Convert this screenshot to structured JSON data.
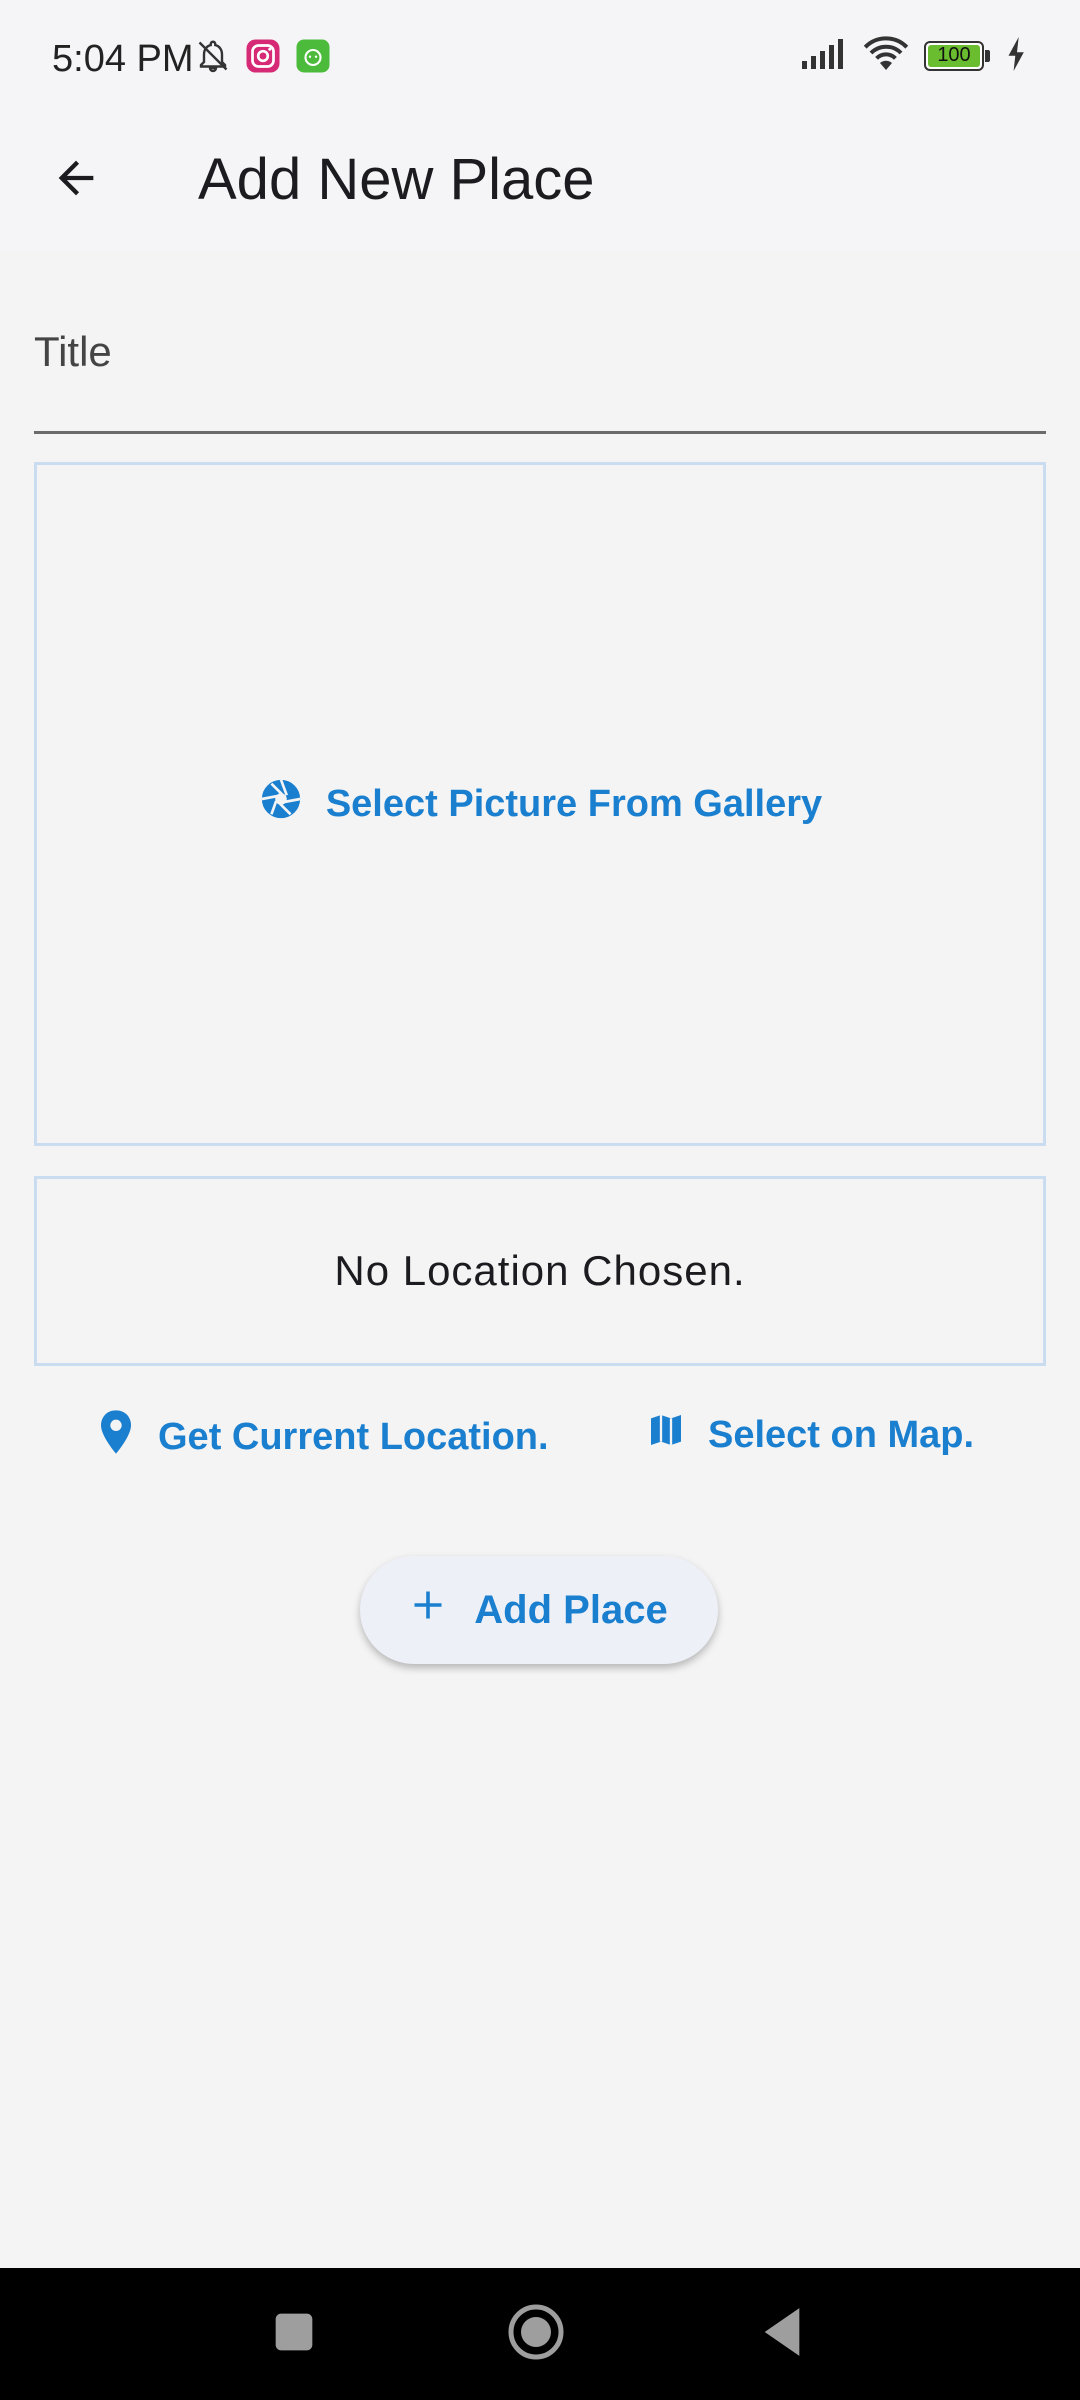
{
  "status_bar": {
    "time": "5:04 PM",
    "battery": "100",
    "icons_left": [
      "bell-off-icon",
      "instagram-icon",
      "android-app-icon"
    ],
    "icons_right": [
      "signal-icon",
      "wifi-icon",
      "battery-icon",
      "charging-icon"
    ]
  },
  "app_bar": {
    "title": "Add New Place",
    "back_icon": "arrow-back-icon"
  },
  "form": {
    "title_label": "Title",
    "title_value": "",
    "select_picture_label": "Select Picture From Gallery",
    "location_status": "No Location Chosen.",
    "get_location_label": "Get Current Location.",
    "select_map_label": "Select on Map.",
    "add_place_label": "Add Place"
  },
  "colors": {
    "accent": "#1a7fcf",
    "box_border": "#c9dcf0",
    "background": "#f4f4f4"
  },
  "nav_bar": {
    "items": [
      "recents-icon",
      "home-icon",
      "back-icon"
    ]
  }
}
